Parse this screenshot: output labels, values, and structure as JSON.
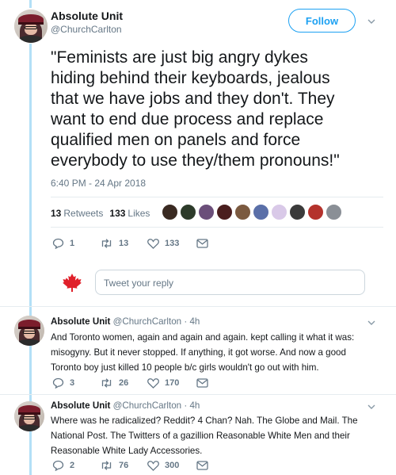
{
  "main_tweet": {
    "author_name": "Absolute Unit",
    "author_handle": "@ChurchCarlton",
    "follow_label": "Follow",
    "lines": [
      "\"Feminists are just big angry dykes",
      "hiding behind their keyboards, jealous",
      "that we have jobs and they don't. They",
      "want to end due process and replace",
      "qualified men on panels and force",
      "everybody to use they/them pronouns!\""
    ],
    "timestamp": "6:40 PM - 24 Apr 2018",
    "retweets_count": "13",
    "retweets_label": "Retweets",
    "likes_count": "133",
    "likes_label": "Likes",
    "liker_avatar_colors": [
      "#3a2a22",
      "#2d3b2a",
      "#6b4f7a",
      "#4a1e1e",
      "#7b5a40",
      "#5a6fa8",
      "#d9c9e8",
      "#3b3b3b",
      "#b4322c",
      "#8a8f96"
    ],
    "actions": {
      "replies": "1",
      "retweets": "13",
      "likes": "133"
    }
  },
  "reply_box": {
    "flag_icon": "maple-leaf-icon",
    "placeholder": "Tweet your reply"
  },
  "replies": [
    {
      "author_name": "Absolute Unit",
      "author_handle": "@ChurchCarlton",
      "time": "· 4h",
      "lines": [
        "And Toronto women, again and again and again. kept calling it what it was:",
        "misogyny. But it never stopped. If anything, it got worse. And now a good",
        "Toronto boy just killed 10 people b/c girls wouldn't go out with him."
      ],
      "actions": {
        "replies": "3",
        "retweets": "26",
        "likes": "170"
      }
    },
    {
      "author_name": "Absolute Unit",
      "author_handle": "@ChurchCarlton",
      "time": "· 4h",
      "lines": [
        "Where was he radicalized? Reddit? 4 Chan? Nah. The Globe and Mail. The",
        "National Post. The Twitters of a gazillion Reasonable White Men and their",
        "Reasonable White Lady Accessories."
      ],
      "actions": {
        "replies": "2",
        "retweets": "76",
        "likes": "300"
      }
    }
  ],
  "colors": {
    "accent": "#1da1f2",
    "thread_line": "#b3e0f7",
    "muted_text": "#657786",
    "flag_red": "#e0202a"
  }
}
